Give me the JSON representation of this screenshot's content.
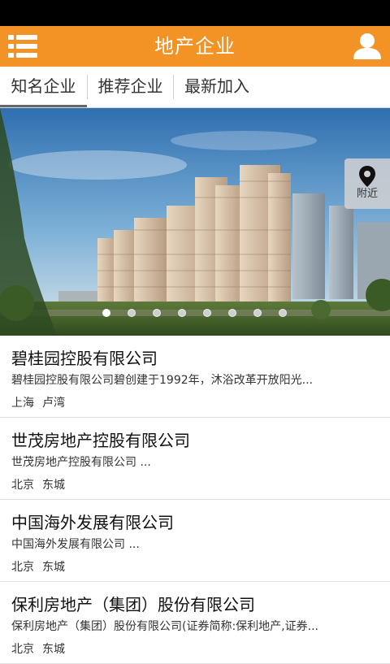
{
  "header": {
    "title": "地产企业",
    "menu_icon": "menu-icon",
    "user_icon": "user-icon",
    "accent": "#f39325"
  },
  "tabs": [
    {
      "label": "知名企业",
      "active": true
    },
    {
      "label": "推荐企业",
      "active": false
    },
    {
      "label": "最新加入",
      "active": false
    }
  ],
  "banner": {
    "nearby_label": "附近",
    "nearby_icon": "location-pin-icon",
    "slides_count": 8,
    "active_slide": 1
  },
  "companies": [
    {
      "name": "碧桂园控股有限公司",
      "desc": "碧桂园控股有限公司碧创建于1992年，沐浴改革开放阳光...",
      "city": "上海",
      "district": "卢湾"
    },
    {
      "name": "世茂房地产控股有限公司",
      "desc": "世茂房地产控股有限公司 ...",
      "city": "北京",
      "district": "东城"
    },
    {
      "name": "中国海外发展有限公司",
      "desc": "中国海外发展有限公司 ...",
      "city": "北京",
      "district": "东城"
    },
    {
      "name": "保利房地产（集团）股份有限公司",
      "desc": "保利房地产（集团）股份有限公司(证券简称:保利地产,证券...",
      "city": "北京",
      "district": "东城"
    }
  ]
}
